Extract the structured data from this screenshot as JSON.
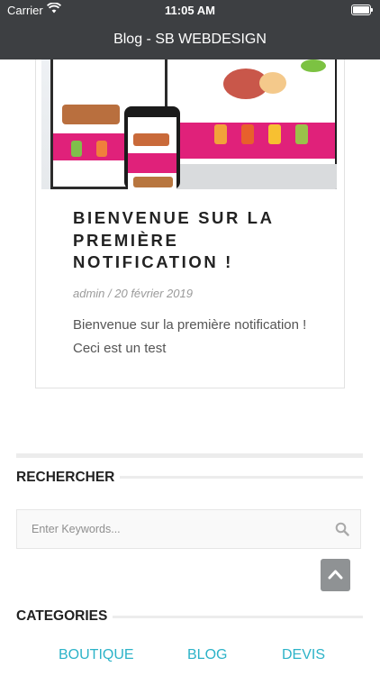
{
  "status_bar": {
    "carrier": "Carrier",
    "time": "11:05 AM"
  },
  "nav": {
    "title": "Blog - SB WEBDESIGN"
  },
  "post": {
    "title": "BIENVENUE SUR LA PREMIÈRE NOTIFICATION !",
    "meta": "admin / 20 février 2019",
    "excerpt": "Bienvenue sur la première notification ! Ceci est un test"
  },
  "search_widget": {
    "heading": "RECHERCHER",
    "placeholder": "Enter Keywords..."
  },
  "categories_widget": {
    "heading": "CATEGORIES",
    "items": [
      {
        "label": "BOUTIQUE"
      },
      {
        "label": "BLOG"
      },
      {
        "label": "DEVIS"
      }
    ]
  },
  "colors": {
    "bar": "#3d3f42",
    "accent": "#2cb3c8",
    "pink": "#e0217a"
  },
  "icons": {
    "search": "search-icon",
    "scroll_top": "chevron-up-icon",
    "wifi": "wifi-icon",
    "battery": "battery-icon"
  }
}
